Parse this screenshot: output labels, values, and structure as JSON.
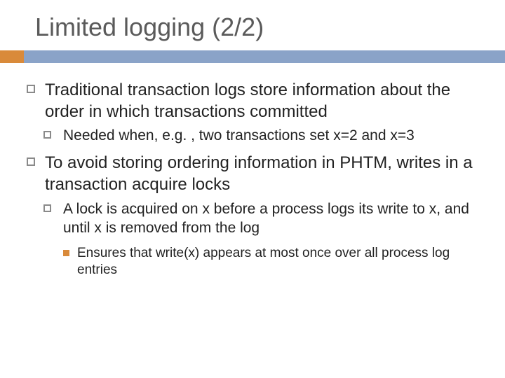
{
  "slide": {
    "title": "Limited logging (2/2)",
    "bullets": [
      {
        "text": "Traditional transaction logs store information about the order in which transactions committed",
        "children": [
          {
            "text": "Needed when, e.g. , two transactions set x=2 and x=3",
            "children": []
          }
        ]
      },
      {
        "text": "To avoid storing ordering information in PHTM, writes in a transaction acquire locks",
        "children": [
          {
            "text": "A lock is acquired on x before a process logs its write to x, and until x is removed from the log",
            "children": [
              {
                "text": "Ensures that write(x) appears at most once over all process log entries",
                "children": []
              }
            ]
          }
        ]
      }
    ]
  }
}
